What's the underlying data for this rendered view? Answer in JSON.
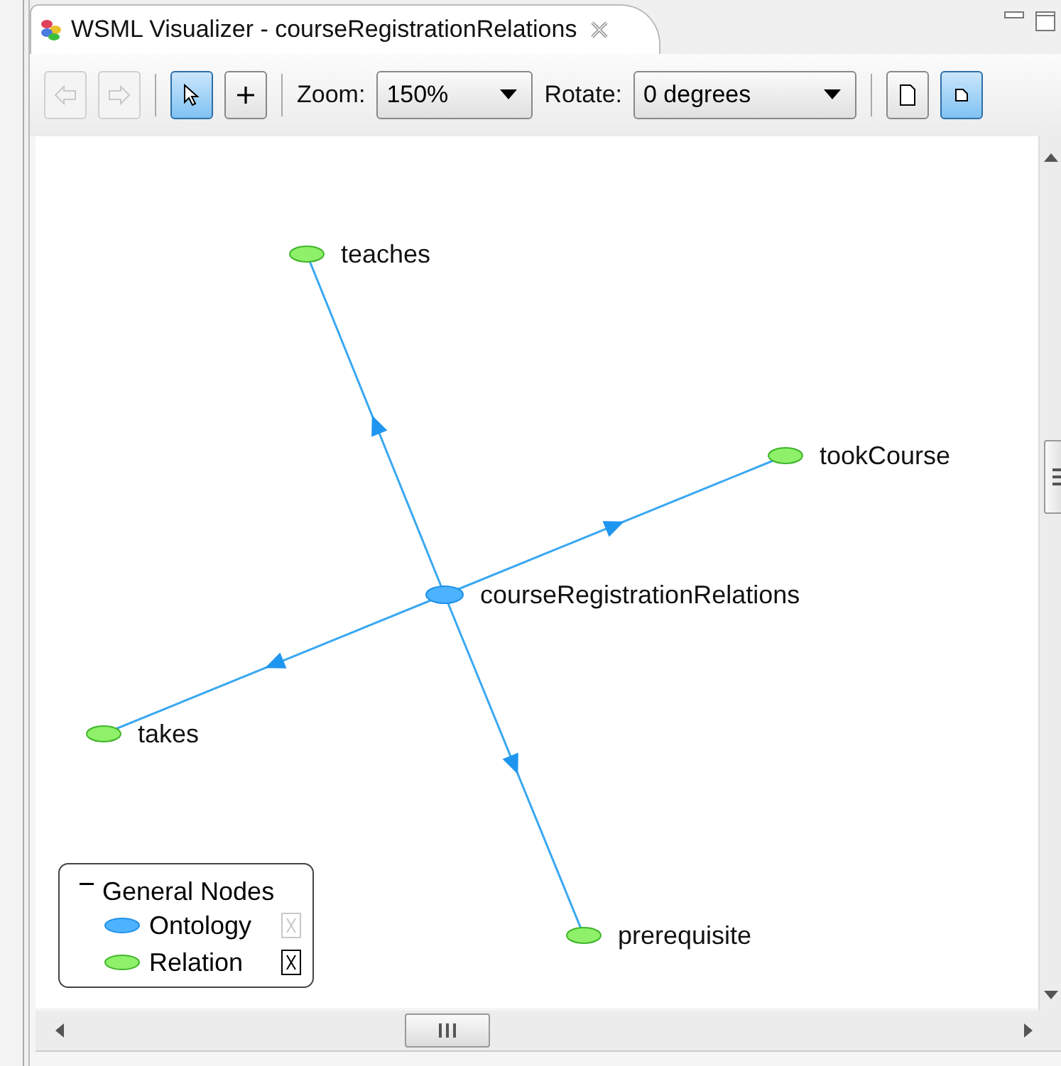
{
  "tab": {
    "title": "WSML Visualizer - courseRegistrationRelations"
  },
  "toolbar": {
    "back": {
      "disabled": true
    },
    "forward": {
      "disabled": true
    },
    "select_tool": {
      "selected": true
    },
    "add_tool": {
      "selected": false
    },
    "zoom": {
      "label": "Zoom:",
      "value": "150%"
    },
    "rotate": {
      "label": "Rotate:",
      "value": "0 degrees"
    },
    "page_buttons": [
      {
        "selected": false
      },
      {
        "selected": true
      }
    ]
  },
  "graph": {
    "nodes": [
      {
        "label": "courseRegistrationRelations",
        "kind": "ontology"
      },
      {
        "label": "teaches",
        "kind": "relation"
      },
      {
        "label": "tookCourse",
        "kind": "relation"
      },
      {
        "label": "takes",
        "kind": "relation"
      },
      {
        "label": "prerequisite",
        "kind": "relation"
      }
    ]
  },
  "legend": {
    "title": "General Nodes",
    "expanded": true,
    "items": [
      {
        "label": "Ontology",
        "kind": "ontology",
        "checked": false
      },
      {
        "label": "Relation",
        "kind": "relation",
        "checked": true
      }
    ]
  }
}
